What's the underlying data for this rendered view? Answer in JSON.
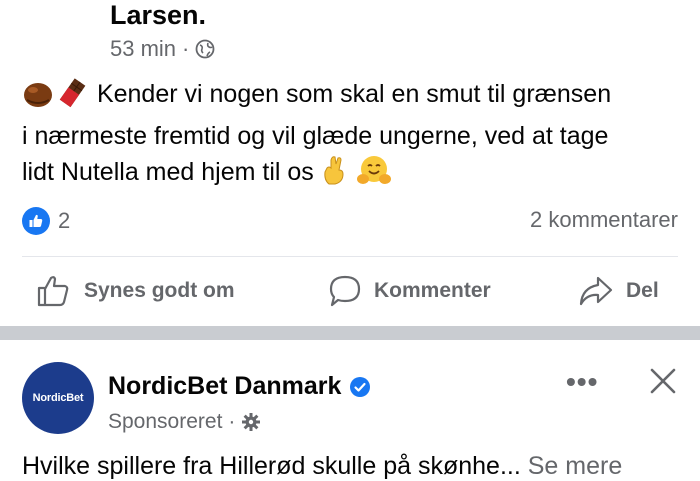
{
  "post1": {
    "author_continuation": "Larsen.",
    "time": "53 min",
    "separator_dot": "·",
    "audience_icon": "globe-icon",
    "text_line1": "Kender vi nogen som skal en smut til grænsen",
    "text_line2": "i nærmeste fremtid og vil glæde ungerne, ved at tage",
    "text_line3": "lidt Nutella med hjem til os",
    "reaction_count": "2",
    "comment_count": "2 kommentarer",
    "actions": {
      "like": "Synes godt om",
      "comment": "Kommenter",
      "share": "Del"
    }
  },
  "post2": {
    "avatar_text": "NordicBet",
    "page_name": "NordicBet Danmark",
    "sponsored": "Sponsoreret",
    "separator_dot": "·",
    "more": "•••",
    "text": "Hvilke spillere fra Hillerød skulle på skønhe...",
    "see_more": "Se mere"
  },
  "colors": {
    "brand_blue": "#1877f2",
    "secondary_text": "#65676b",
    "avatar_bg": "#1c3c8c",
    "separator": "#c9ccd1"
  }
}
